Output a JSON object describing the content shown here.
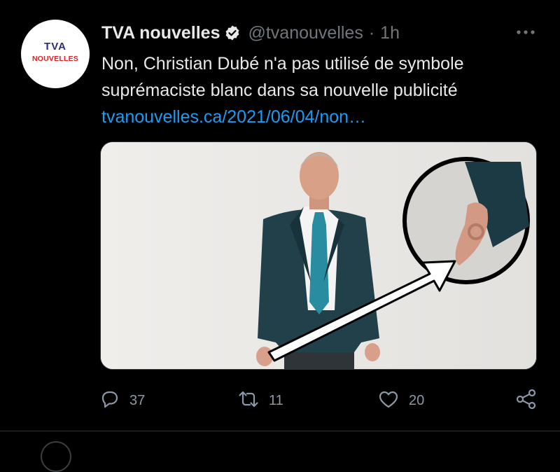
{
  "tweet": {
    "avatar": {
      "brand_top": "TVA",
      "brand_bottom": "NOUVELLES",
      "icon": "tva-nouvelles-logo"
    },
    "display_name": "TVA nouvelles",
    "verified_icon": "verified-badge-icon",
    "handle": "@tvanouvelles",
    "separator": "·",
    "time": "1h",
    "more_icon": "more-options-icon",
    "text_line1": "Non, Christian Dubé n'a pas utilisé de symbole",
    "text_line2": "suprémaciste blanc dans sa nouvelle publicité",
    "link": "tvanouvelles.ca/2021/06/04/non…",
    "media": {
      "description_icon": "photo-man-in-suit-with-arrow-and-circled-hand"
    },
    "actions": {
      "reply": {
        "icon": "reply-icon",
        "count": "37"
      },
      "retweet": {
        "icon": "retweet-icon",
        "count": "11"
      },
      "like": {
        "icon": "heart-icon",
        "count": "20"
      },
      "share": {
        "icon": "share-icon"
      }
    }
  },
  "colors": {
    "background": "#000000",
    "text": "#e7e9ea",
    "muted": "#71767b",
    "link": "#1d9bf0",
    "action": "#8b98a5",
    "brand_red": "#e31d23",
    "brand_blue": "#2b2f7a"
  }
}
